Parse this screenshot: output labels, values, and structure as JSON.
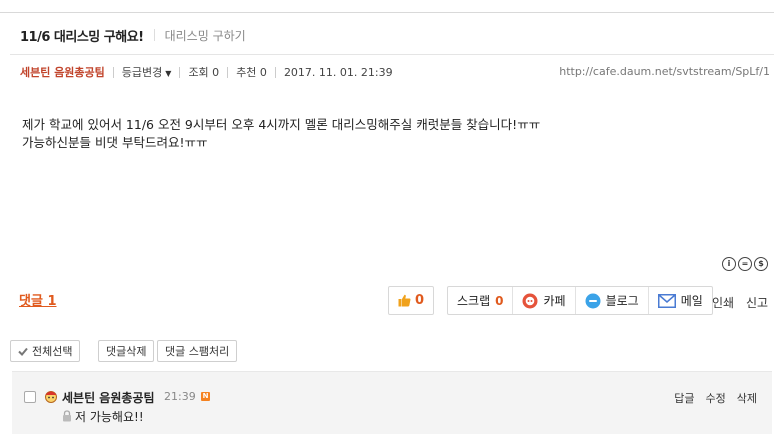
{
  "post": {
    "title": "11/6 대리스밍 구해요!",
    "category": "대리스밍 구하기",
    "author": "세븐틴 음원총공팀",
    "grade_change": "등급변경",
    "views": "조회 0",
    "recommends": "추천 0",
    "date": "2017. 11. 01.  21:39",
    "permalink": "http://cafe.daum.net/svtstream/SpLf/1",
    "content_lines": [
      "제가 학교에 있어서 11/6 오전 9시부터 오후 4시까지 멜론 대리스밍해주실 캐럿분들 찾습니다!ㅠㅠ",
      "가능하신분들 비댓 부탁드려요!ㅠㅠ"
    ]
  },
  "license_icons": [
    "cc-by-icon",
    "cc-nd-icon",
    "cc-nc-icon"
  ],
  "actions": {
    "comments_link": "댓글 1",
    "like_count": "0",
    "scrap_label": "스크랩",
    "scrap_count": "0",
    "cafe_label": "카페",
    "blog_label": "블로그",
    "mail_label": "메일",
    "print_label": "인쇄",
    "report_label": "신고"
  },
  "comment_tools": {
    "select_all": "전체선택",
    "delete": "댓글삭제",
    "spam": "댓글 스팸처리"
  },
  "comments": [
    {
      "author": "세븐틴 음원총공팀",
      "time": "21:39",
      "text": "저 가능해요!!",
      "reply": "답글",
      "edit": "수정",
      "delete": "삭제"
    }
  ],
  "colors": {
    "accent": "#e05a1e",
    "author": "#c1442b",
    "cafe_icon": "#e5533b",
    "blog_icon": "#3ba3e8",
    "mail_icon": "#4a7bd3"
  }
}
